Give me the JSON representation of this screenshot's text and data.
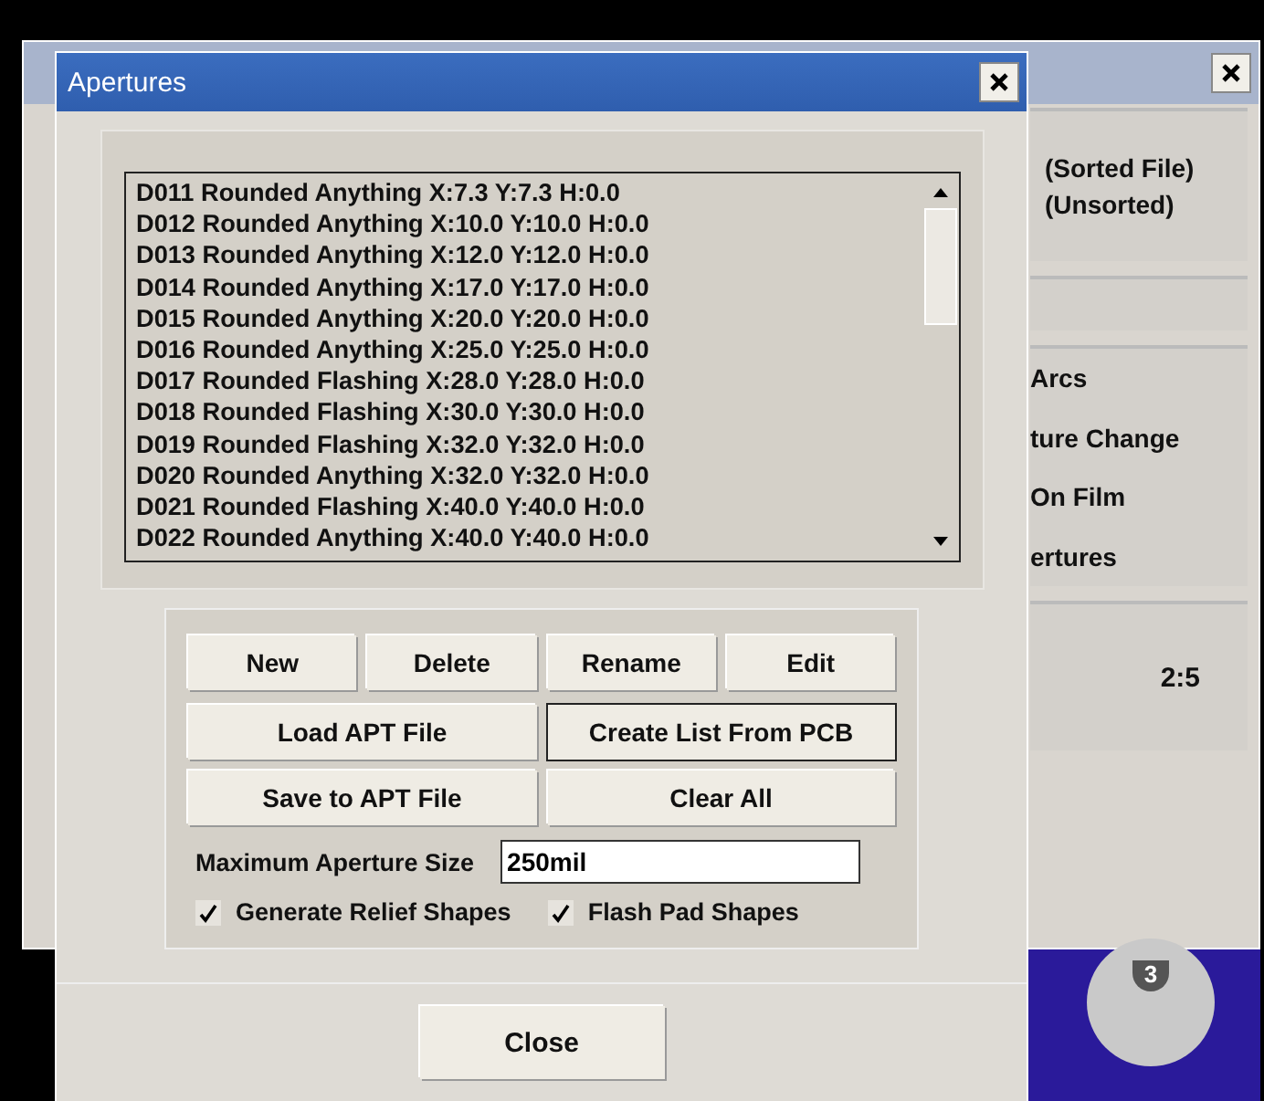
{
  "background_window": {
    "sort_options": [
      "(Sorted File)",
      "(Unsorted)"
    ],
    "display_options": [
      "Arcs",
      "ture Change",
      "On Film",
      "ertures"
    ],
    "ratio": "2:5",
    "badge": "3"
  },
  "dialog": {
    "title": "Apertures",
    "apertures": [
      "D011 Rounded Anything X:7.3 Y:7.3 H:0.0",
      "D012 Rounded Anything X:10.0 Y:10.0 H:0.0",
      "D013 Rounded Anything X:12.0 Y:12.0 H:0.0",
      "D014 Rounded Anything X:17.0 Y:17.0 H:0.0",
      "D015 Rounded Anything X:20.0 Y:20.0 H:0.0",
      "D016 Rounded Anything X:25.0 Y:25.0 H:0.0",
      "D017 Rounded Flashing X:28.0 Y:28.0 H:0.0",
      "D018 Rounded Flashing X:30.0 Y:30.0 H:0.0",
      "D019 Rounded Flashing X:32.0 Y:32.0 H:0.0",
      "D020 Rounded Anything X:32.0 Y:32.0 H:0.0",
      "D021 Rounded Flashing X:40.0 Y:40.0 H:0.0",
      "D022 Rounded Anything X:40.0 Y:40.0 H:0.0"
    ],
    "row_buttons": [
      "New",
      "Delete",
      "Rename",
      "Edit"
    ],
    "file_buttons": [
      {
        "label": "Load APT File",
        "focused": false
      },
      {
        "label": "Create List From PCB",
        "focused": true
      },
      {
        "label": "Save to APT File",
        "focused": false
      },
      {
        "label": "Clear All",
        "focused": false
      }
    ],
    "max_size": {
      "label": "Maximum Aperture Size",
      "value": "250mil"
    },
    "options": [
      {
        "label": "Generate Relief Shapes",
        "checked": true
      },
      {
        "label": "Flash Pad Shapes",
        "checked": true
      }
    ],
    "close_button": "Close"
  }
}
